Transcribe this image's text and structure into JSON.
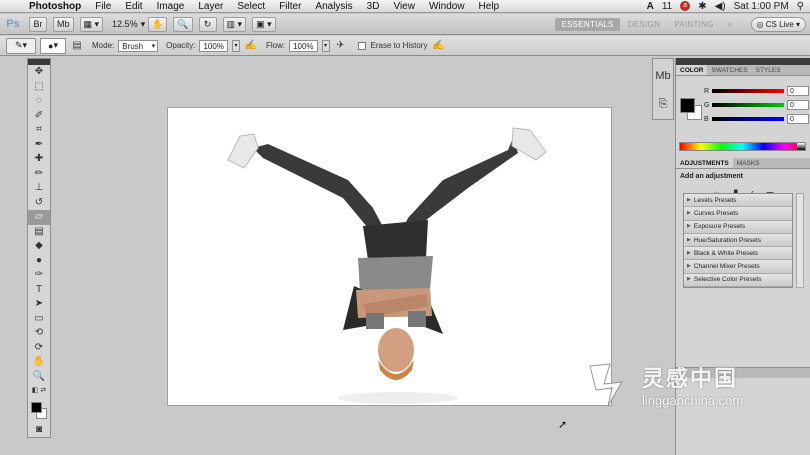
{
  "menubar": {
    "app": "Photoshop",
    "items": [
      "File",
      "Edit",
      "Image",
      "Layer",
      "Select",
      "Filter",
      "Analysis",
      "3D",
      "View",
      "Window",
      "Help"
    ],
    "status_number": "11",
    "clock": "Sat 1:00 PM"
  },
  "appbar": {
    "logo": "Ps",
    "zoom": "12.5%",
    "workspaces": [
      "ESSENTIALS",
      "DESIGN",
      "PAINTING"
    ],
    "more": "»",
    "cs_live": "CS Live"
  },
  "options": {
    "mode_label": "Mode:",
    "mode_value": "Brush",
    "opacity_label": "Opacity:",
    "opacity_value": "100%",
    "flow_label": "Flow:",
    "flow_value": "100%",
    "erase_history_label": "Erase to History"
  },
  "color_panel": {
    "tabs": [
      "COLOR",
      "SWATCHES",
      "STYLES"
    ],
    "channels": [
      {
        "label": "R",
        "value": "0",
        "color": "#d22"
      },
      {
        "label": "G",
        "value": "0",
        "color": "#1a1"
      },
      {
        "label": "B",
        "value": "0",
        "color": "#22c"
      }
    ]
  },
  "adjustments_panel": {
    "tabs": [
      "ADJUSTMENTS",
      "MASKS"
    ],
    "title": "Add an adjustment",
    "presets": [
      "Levels Presets",
      "Curves Presets",
      "Exposure Presets",
      "Hue/Saturation Presets",
      "Black & White Presets",
      "Channel Mixer Presets",
      "Selective Color Presets"
    ]
  },
  "watermark": {
    "cn": "灵感中国",
    "en": "lingganchina.com"
  }
}
